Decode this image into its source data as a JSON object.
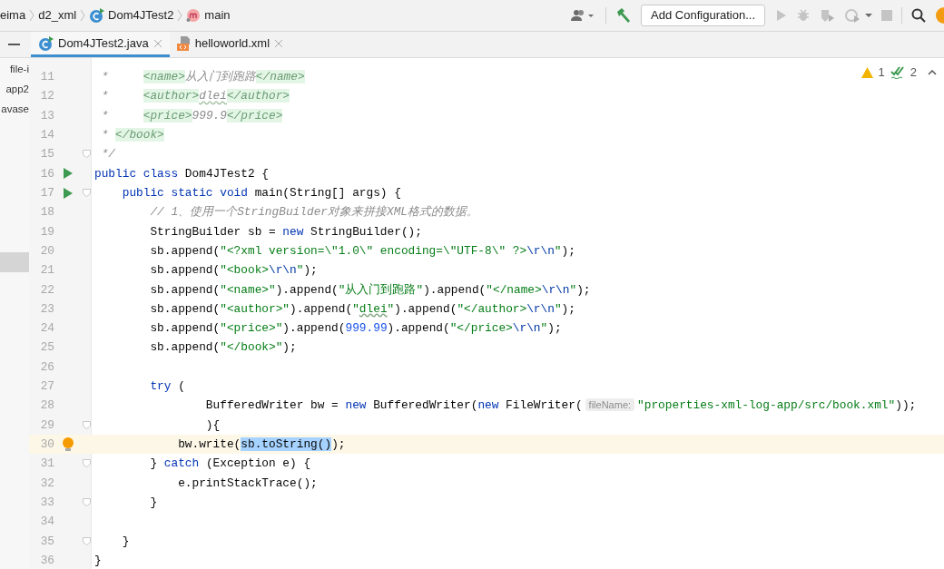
{
  "breadcrumbs": [
    {
      "kind": "folder",
      "label": "eima"
    },
    {
      "kind": "folder",
      "label": "d2_xml"
    },
    {
      "kind": "class",
      "label": "Dom4JTest2"
    },
    {
      "kind": "method",
      "label": "main"
    }
  ],
  "toolbar": {
    "run_config_button": "Add Configuration..."
  },
  "tabs": [
    {
      "kind": "java",
      "label": "Dom4JTest2.java",
      "selected": true
    },
    {
      "kind": "xml",
      "label": "helloworld.xml",
      "selected": false
    }
  ],
  "project_tree": [
    {
      "label": "file-i",
      "selected": false
    },
    {
      "label": "app2",
      "selected": false
    },
    {
      "label": "avase",
      "selected": false
    },
    {
      "selected": true
    }
  ],
  "inspections": {
    "warnings": "1",
    "weak_warnings": "2"
  },
  "lines": [
    {
      "number": "11",
      "current": false,
      "fold": false,
      "tokens": [
        {
          "kind": "comment",
          "text": " *     "
        },
        {
          "kind": "doc_tag",
          "text": "<name>"
        },
        {
          "kind": "comment",
          "text": "从入门到跑路"
        },
        {
          "kind": "doc_tag",
          "text": "</name>"
        }
      ]
    },
    {
      "number": "12",
      "current": false,
      "fold": false,
      "tokens": [
        {
          "kind": "comment",
          "text": " *     "
        },
        {
          "kind": "doc_tag",
          "text": "<author>"
        },
        {
          "kind": "comment_typo",
          "text": "dlei"
        },
        {
          "kind": "doc_tag",
          "text": "</author>"
        }
      ]
    },
    {
      "number": "13",
      "current": false,
      "fold": false,
      "tokens": [
        {
          "kind": "comment",
          "text": " *     "
        },
        {
          "kind": "doc_tag",
          "text": "<price>"
        },
        {
          "kind": "comment",
          "text": "999.9"
        },
        {
          "kind": "doc_tag",
          "text": "</price>"
        }
      ]
    },
    {
      "number": "14",
      "current": false,
      "fold": false,
      "tokens": [
        {
          "kind": "comment",
          "text": " * "
        },
        {
          "kind": "doc_tag",
          "text": "</book>"
        }
      ]
    },
    {
      "number": "15",
      "current": false,
      "fold": true,
      "tokens": [
        {
          "kind": "comment",
          "text": " */"
        }
      ]
    },
    {
      "number": "16",
      "current": false,
      "fold": false,
      "runnable": true,
      "tokens": [
        {
          "kind": "keyword",
          "text": "public class "
        },
        {
          "kind": "plain",
          "text": "Dom4JTest2 {"
        }
      ]
    },
    {
      "number": "17",
      "current": false,
      "fold": true,
      "runnable": true,
      "tokens": [
        {
          "kind": "keyword",
          "text": "    public static void "
        },
        {
          "kind": "plain",
          "text": "main(String[] args) {"
        }
      ]
    },
    {
      "number": "18",
      "current": false,
      "fold": false,
      "tokens": [
        {
          "kind": "comment",
          "text": "        // 1、使用一个StringBuilder对象来拼接XML格式的数据。"
        }
      ]
    },
    {
      "number": "19",
      "current": false,
      "fold": false,
      "tokens": [
        {
          "kind": "plain",
          "text": "        StringBuilder sb = "
        },
        {
          "kind": "keyword",
          "text": "new"
        },
        {
          "kind": "plain",
          "text": " StringBuilder();"
        }
      ]
    },
    {
      "number": "20",
      "current": false,
      "fold": false,
      "tokens": [
        {
          "kind": "plain",
          "text": "        sb.append("
        },
        {
          "kind": "string",
          "text": "\"<?xml version=\\\"1.0\\\" encoding=\\\"UTF-8\\\" ?>"
        },
        {
          "kind": "escape",
          "text": "\\r\\n"
        },
        {
          "kind": "string",
          "text": "\""
        },
        {
          "kind": "plain",
          "text": ");"
        }
      ]
    },
    {
      "number": "21",
      "current": false,
      "fold": false,
      "tokens": [
        {
          "kind": "plain",
          "text": "        sb.append("
        },
        {
          "kind": "string",
          "text": "\"<book>"
        },
        {
          "kind": "escape",
          "text": "\\r\\n"
        },
        {
          "kind": "string",
          "text": "\""
        },
        {
          "kind": "plain",
          "text": ");"
        }
      ]
    },
    {
      "number": "22",
      "current": false,
      "fold": false,
      "tokens": [
        {
          "kind": "plain",
          "text": "        sb.append("
        },
        {
          "kind": "string",
          "text": "\"<name>\""
        },
        {
          "kind": "plain",
          "text": ").append("
        },
        {
          "kind": "string",
          "text": "\"从入门到跑路\""
        },
        {
          "kind": "plain",
          "text": ").append("
        },
        {
          "kind": "string",
          "text": "\"</name>"
        },
        {
          "kind": "escape",
          "text": "\\r\\n"
        },
        {
          "kind": "string",
          "text": "\""
        },
        {
          "kind": "plain",
          "text": ");"
        }
      ]
    },
    {
      "number": "23",
      "current": false,
      "fold": false,
      "tokens": [
        {
          "kind": "plain",
          "text": "        sb.append("
        },
        {
          "kind": "string",
          "text": "\"<author>\""
        },
        {
          "kind": "plain",
          "text": ").append("
        },
        {
          "kind": "string",
          "text": "\""
        },
        {
          "kind": "string_typo",
          "text": "dlei"
        },
        {
          "kind": "string",
          "text": "\""
        },
        {
          "kind": "plain",
          "text": ").append("
        },
        {
          "kind": "string",
          "text": "\"</author>"
        },
        {
          "kind": "escape",
          "text": "\\r\\n"
        },
        {
          "kind": "string",
          "text": "\""
        },
        {
          "kind": "plain",
          "text": ");"
        }
      ]
    },
    {
      "number": "24",
      "current": false,
      "fold": false,
      "tokens": [
        {
          "kind": "plain",
          "text": "        sb.append("
        },
        {
          "kind": "string",
          "text": "\"<price>\""
        },
        {
          "kind": "plain",
          "text": ").append("
        },
        {
          "kind": "number",
          "text": "999.99"
        },
        {
          "kind": "plain",
          "text": ").append("
        },
        {
          "kind": "string",
          "text": "\"</price>"
        },
        {
          "kind": "escape",
          "text": "\\r\\n"
        },
        {
          "kind": "string",
          "text": "\""
        },
        {
          "kind": "plain",
          "text": ");"
        }
      ]
    },
    {
      "number": "25",
      "current": false,
      "fold": false,
      "tokens": [
        {
          "kind": "plain",
          "text": "        sb.append("
        },
        {
          "kind": "string",
          "text": "\"</book>\""
        },
        {
          "kind": "plain",
          "text": ");"
        }
      ]
    },
    {
      "number": "26",
      "current": false,
      "fold": false
    },
    {
      "number": "27",
      "current": false,
      "fold": false,
      "tokens": [
        {
          "kind": "keyword",
          "text": "        try"
        },
        {
          "kind": "plain",
          "text": " ("
        }
      ]
    },
    {
      "number": "28",
      "current": false,
      "fold": false,
      "tokens": [
        {
          "kind": "plain",
          "text": "                BufferedWriter bw = "
        },
        {
          "kind": "keyword",
          "text": "new"
        },
        {
          "kind": "plain",
          "text": " BufferedWriter("
        },
        {
          "kind": "keyword",
          "text": "new"
        },
        {
          "kind": "plain",
          "text": " FileWriter("
        },
        {
          "kind": "hint",
          "text": "fileName:"
        },
        {
          "kind": "string",
          "text": "\"properties-xml-log-app/src/book.xml\""
        },
        {
          "kind": "plain",
          "text": "));"
        }
      ]
    },
    {
      "number": "29",
      "current": false,
      "fold": true,
      "tokens": [
        {
          "kind": "plain",
          "text": "                ){"
        }
      ]
    },
    {
      "number": "30",
      "current": true,
      "fold": false,
      "intention_bulb": true,
      "tokens": [
        {
          "kind": "plain",
          "text": "            bw.write("
        },
        {
          "kind": "selection",
          "text": "sb.toString()"
        },
        {
          "kind": "plain",
          "text": ");"
        }
      ]
    },
    {
      "number": "31",
      "current": false,
      "fold": true,
      "tokens": [
        {
          "kind": "plain",
          "text": "        } "
        },
        {
          "kind": "keyword",
          "text": "catch"
        },
        {
          "kind": "plain",
          "text": " (Exception e) {"
        }
      ]
    },
    {
      "number": "32",
      "current": false,
      "fold": false,
      "tokens": [
        {
          "kind": "plain",
          "text": "            e.printStackTrace();"
        }
      ]
    },
    {
      "number": "33",
      "current": false,
      "fold": true,
      "tokens": [
        {
          "kind": "plain",
          "text": "        }"
        }
      ]
    },
    {
      "number": "34",
      "current": false,
      "fold": false
    },
    {
      "number": "35",
      "current": false,
      "fold": true,
      "tokens": [
        {
          "kind": "plain",
          "text": "    }"
        }
      ]
    },
    {
      "number": "36",
      "current": false,
      "fold": false,
      "tokens": [
        {
          "kind": "plain",
          "text": "}"
        }
      ]
    }
  ]
}
